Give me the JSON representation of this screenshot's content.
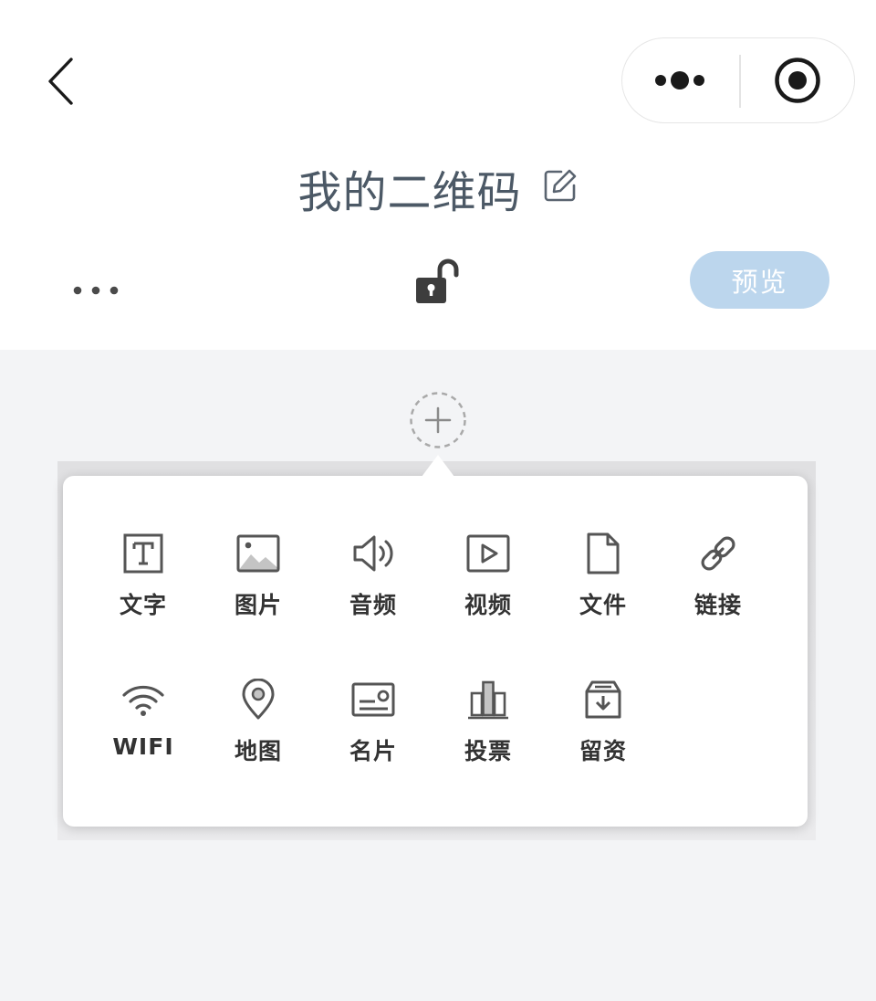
{
  "nav": {
    "back_icon": "chevron-left-icon",
    "more_icon": "more-dots-icon",
    "close_icon": "target-circle-icon"
  },
  "header": {
    "title": "我的二维码",
    "edit_icon": "edit-icon"
  },
  "toolbar": {
    "more_icon": "ellipsis-icon",
    "lock_icon": "unlocked-padlock-icon",
    "preview_label": "预览"
  },
  "add_icon": "add-circle-dashed-icon",
  "colors": {
    "preview_bg": "#bcd6ed",
    "title": "#4c5966",
    "page_bg": "#f3f4f6",
    "icon": "#555555"
  },
  "menu": {
    "items": [
      {
        "label": "文字",
        "icon": "text-icon"
      },
      {
        "label": "图片",
        "icon": "image-icon"
      },
      {
        "label": "音频",
        "icon": "audio-icon"
      },
      {
        "label": "视频",
        "icon": "video-icon"
      },
      {
        "label": "文件",
        "icon": "file-icon"
      },
      {
        "label": "链接",
        "icon": "link-icon"
      },
      {
        "label": "WIFI",
        "icon": "wifi-icon"
      },
      {
        "label": "地图",
        "icon": "map-pin-icon"
      },
      {
        "label": "名片",
        "icon": "business-card-icon"
      },
      {
        "label": "投票",
        "icon": "vote-bar-icon"
      },
      {
        "label": "留资",
        "icon": "collect-info-icon"
      }
    ]
  }
}
